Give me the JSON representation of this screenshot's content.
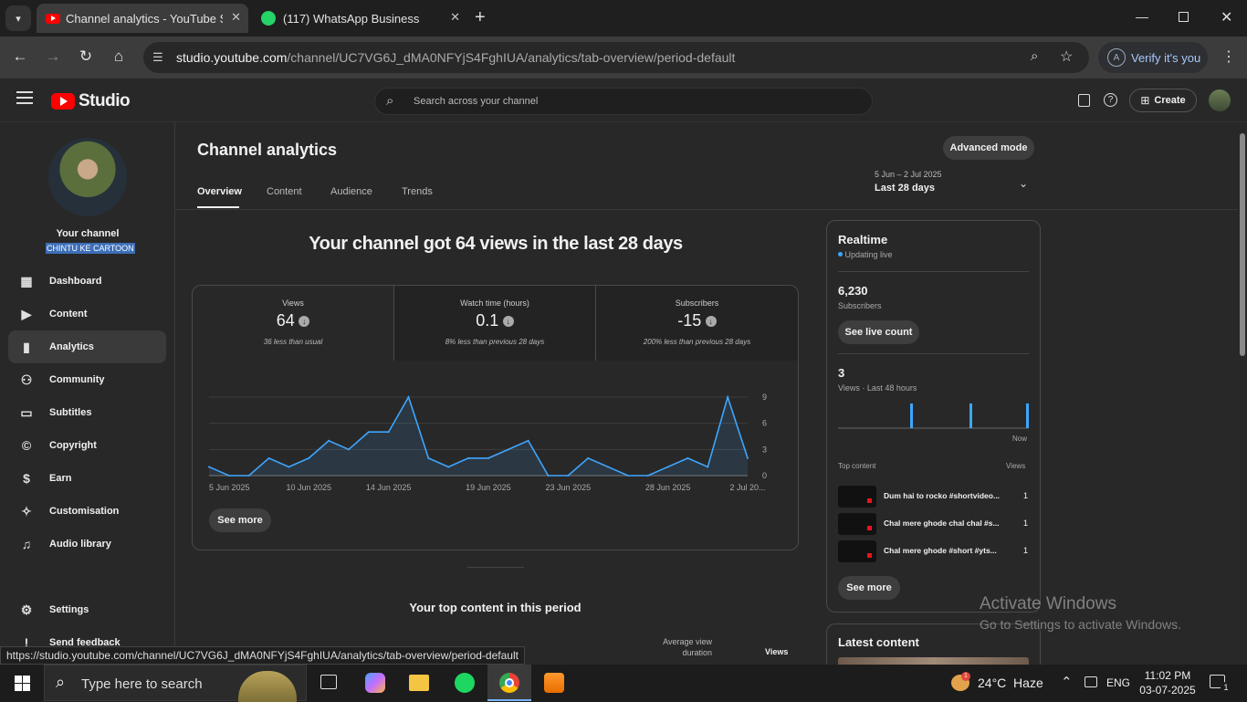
{
  "browser": {
    "tabs": [
      {
        "title": "Channel analytics - YouTube Studio"
      },
      {
        "title": "(117) WhatsApp Business"
      }
    ],
    "url_domain": "studio.youtube.com",
    "url_path": "/channel/UC7VG6J_dMA0NFYjS4FghIUA/analytics/tab-overview/period-default",
    "verify_label": "Verify it's you",
    "new_tab_symbol": "+",
    "status_url": "https://studio.youtube.com/channel/UC7VG6J_dMA0NFYjS4FghIUA/analytics/tab-overview/period-default"
  },
  "studio": {
    "logo_text": "Studio",
    "search_placeholder": "Search across your channel",
    "create_label": "Create"
  },
  "sidebar": {
    "your_channel": "Your channel",
    "channel_name": "CHINTU KE CARTOON",
    "items": [
      {
        "label": "Dashboard",
        "icon": "dashboard-icon"
      },
      {
        "label": "Content",
        "icon": "content-icon"
      },
      {
        "label": "Analytics",
        "icon": "analytics-icon"
      },
      {
        "label": "Community",
        "icon": "community-icon"
      },
      {
        "label": "Subtitles",
        "icon": "subtitles-icon"
      },
      {
        "label": "Copyright",
        "icon": "copyright-icon"
      },
      {
        "label": "Earn",
        "icon": "earn-icon"
      },
      {
        "label": "Customisation",
        "icon": "customisation-icon"
      },
      {
        "label": "Audio library",
        "icon": "audio-library-icon"
      }
    ],
    "settings": "Settings",
    "feedback": "Send feedback"
  },
  "analytics": {
    "page_title": "Channel analytics",
    "advanced_mode": "Advanced mode",
    "tabs": [
      "Overview",
      "Content",
      "Audience",
      "Trends"
    ],
    "period_dates": "5 Jun – 2 Jul 2025",
    "period_label": "Last 28 days",
    "headline": "Your channel got 64 views in the last 28 days",
    "metrics": [
      {
        "label": "Views",
        "value": "64",
        "note": "36 less than usual"
      },
      {
        "label": "Watch time (hours)",
        "value": "0.1",
        "note": "8% less than previous 28 days"
      },
      {
        "label": "Subscribers",
        "value": "-15",
        "note": "200% less than previous 28 days"
      }
    ],
    "see_more": "See more",
    "top_content_title": "Your top content in this period",
    "table_headers": [
      "Average view duration",
      "Views"
    ]
  },
  "chart_data": {
    "type": "area",
    "x": [
      "5 Jun 2025",
      "6 Jun 2025",
      "7 Jun 2025",
      "8 Jun 2025",
      "9 Jun 2025",
      "10 Jun 2025",
      "11 Jun 2025",
      "12 Jun 2025",
      "13 Jun 2025",
      "14 Jun 2025",
      "15 Jun 2025",
      "16 Jun 2025",
      "17 Jun 2025",
      "18 Jun 2025",
      "19 Jun 2025",
      "20 Jun 2025",
      "21 Jun 2025",
      "22 Jun 2025",
      "23 Jun 2025",
      "24 Jun 2025",
      "25 Jun 2025",
      "26 Jun 2025",
      "27 Jun 2025",
      "28 Jun 2025",
      "29 Jun 2025",
      "30 Jun 2025",
      "1 Jul 2025",
      "2 Jul 2025"
    ],
    "series": [
      {
        "values": [
          1,
          0,
          0,
          2,
          1,
          2,
          4,
          3,
          5,
          5,
          9,
          2,
          1,
          2,
          2,
          3,
          4,
          0,
          0,
          2,
          1,
          0,
          0,
          1,
          2,
          1,
          9,
          2
        ]
      }
    ],
    "x_tick_labels": [
      "5 Jun 2025",
      "10 Jun 2025",
      "14 Jun 2025",
      "19 Jun 2025",
      "23 Jun 2025",
      "28 Jun 2025",
      "2 Jul 20..."
    ],
    "y_ticks": [
      "9",
      "6",
      "3",
      "0"
    ],
    "ylim": [
      0,
      9
    ],
    "grid": true,
    "color": "#3ea6ff"
  },
  "realtime": {
    "title": "Realtime",
    "status": "Updating live",
    "subscribers_value": "6,230",
    "subscribers_label": "Subscribers",
    "see_live_count": "See live count",
    "views_value": "3",
    "views_label": "Views · Last 48 hours",
    "spark_values": [
      0,
      0,
      0,
      0,
      0,
      0,
      0,
      0,
      0,
      0,
      0,
      0,
      0,
      0,
      0,
      0,
      0,
      0,
      0,
      0,
      0,
      0,
      0,
      0,
      0,
      0,
      0,
      0,
      0,
      0,
      0,
      0,
      0,
      0,
      0,
      0,
      0,
      0,
      0,
      0,
      0,
      0,
      0,
      0,
      0,
      0,
      1,
      1
    ],
    "now_label": "Now",
    "top_content_label": "Top content",
    "views_col": "Views",
    "items": [
      {
        "title": "Dum hai to rocko #shortvideo...",
        "views": "1"
      },
      {
        "title": "Chal mere ghode chal chal #s...",
        "views": "1"
      },
      {
        "title": "Chal mere ghode #short #yts...",
        "views": "1"
      }
    ],
    "see_more": "See more",
    "latest_content": "Latest content"
  },
  "watermark": {
    "line1": "Activate Windows",
    "line2": "Go to Settings to activate Windows."
  },
  "taskbar": {
    "search_placeholder": "Type here to search",
    "weather": "24°C  Haze",
    "lang": "ENG",
    "time": "11:02 PM",
    "date": "03-07-2025",
    "notif_count": "1",
    "weather_badge": "1"
  },
  "colors": {
    "accent": "#3ea6ff",
    "youtube_red": "#ff0000",
    "whatsapp_green": "#25d366"
  }
}
